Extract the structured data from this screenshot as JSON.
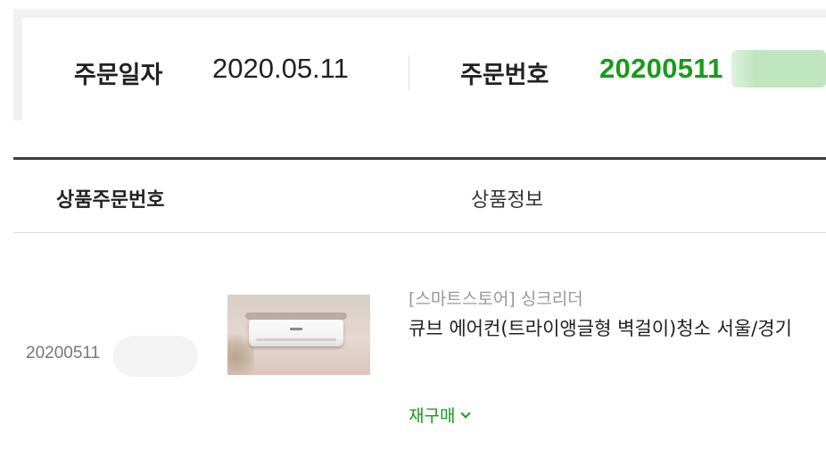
{
  "order_summary": {
    "date_label": "주문일자",
    "date_value": "2020.05.11",
    "number_label": "주문번호",
    "number_value": "20200511"
  },
  "table": {
    "headers": {
      "product_order_number": "상품주문번호",
      "product_info": "상품정보"
    },
    "rows": [
      {
        "product_order_number": "20200511",
        "store_name": "[스마트스토어] 싱크리더",
        "product_title": "큐브 에어컨(트라이앵글형 벽걸이)청소 서울/경기",
        "rebuy_label": "재구매",
        "thumbnail_icon": "air-conditioner-photo"
      }
    ]
  },
  "colors": {
    "accent_green": "#1a9a1a",
    "dark_line": "#3b3f45",
    "muted_text": "#999999"
  },
  "icons": {
    "rebuy_chevron": "chevron-down-icon"
  }
}
